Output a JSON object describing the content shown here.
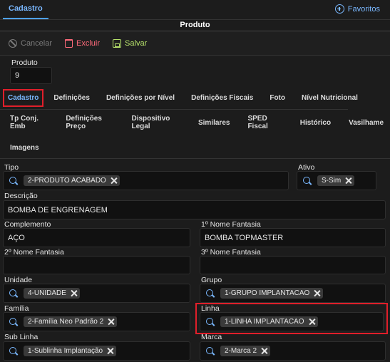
{
  "top": {
    "tab": "Cadastro",
    "favorites": "Favoritos"
  },
  "title": "Produto",
  "toolbar": {
    "cancel": "Cancelar",
    "delete": "Excluir",
    "save": "Salvar"
  },
  "produto": {
    "label": "Produto",
    "value": "9"
  },
  "tabs_row1": [
    "Cadastro",
    "Definições",
    "Definições por Nível",
    "Definições Fiscais",
    "Foto",
    "Nível Nutricional"
  ],
  "tabs_row2": [
    "Tp Conj. Emb",
    "Definições Preço",
    "Dispositivo Legal",
    "Similares",
    "SPED Fiscal",
    "Histórico",
    "Vasilhame"
  ],
  "tabs_row3": [
    "Imagens"
  ],
  "fields": {
    "tipo": {
      "label": "Tipo",
      "chip": "2-PRODUTO ACABADO"
    },
    "ativo": {
      "label": "Ativo",
      "chip": "S-Sim"
    },
    "descricao": {
      "label": "Descrição",
      "value": "BOMBA DE ENGRENAGEM"
    },
    "complemento": {
      "label": "Complemento",
      "value": "AÇO"
    },
    "nome_fantasia_1": {
      "label": "1º Nome Fantasia",
      "value": "BOMBA TOPMASTER"
    },
    "nome_fantasia_2": {
      "label": "2º Nome Fantasia",
      "value": ""
    },
    "nome_fantasia_3": {
      "label": "3º Nome Fantasia",
      "value": ""
    },
    "unidade": {
      "label": "Unidade",
      "chip": "4-UNIDADE"
    },
    "grupo": {
      "label": "Grupo",
      "chip": "1-GRUPO IMPLANTACAO"
    },
    "familia": {
      "label": "Família",
      "chip": "2-Família Neo Padrão 2"
    },
    "linha": {
      "label": "Linha",
      "chip": "1-LINHA IMPLANTACAO"
    },
    "sub_linha": {
      "label": "Sub Linha",
      "chip": "1-Sublinha Implantação"
    },
    "marca": {
      "label": "Marca",
      "chip": "2-Marca 2"
    }
  },
  "colors": {
    "accent": "#7ab8ff",
    "highlight": "#e01f2a",
    "delete": "#ff6a7a",
    "save": "#b7e36b"
  }
}
